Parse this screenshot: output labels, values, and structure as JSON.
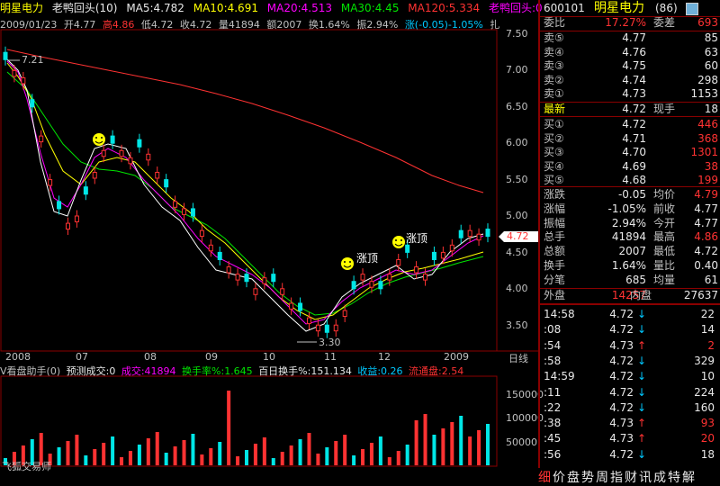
{
  "header": {
    "stock_name": "明星电力",
    "indicator": "老鸭回头(10)",
    "ma5": "MA5:4.782",
    "ma10": "MA10:4.691",
    "ma20": "MA20:4.513",
    "ma30": "MA30:4.45",
    "ma120": "MA120:5.334",
    "indicator_value": "老鸭回头:0"
  },
  "info": {
    "date": "2009/01/23",
    "open": "开4.77",
    "high": "高4.86",
    "low": "低4.72",
    "close": "收4.72",
    "volume": "量41894",
    "amount": "额2007",
    "turnover": "换1.64%",
    "amplitude": "振2.94%",
    "change": "涨(-0.05)-1.05%",
    "trailing": "扎"
  },
  "price_axis": [
    "7.50",
    "7.00",
    "6.50",
    "6.00",
    "5.50",
    "5.00",
    "4.50",
    "4.00",
    "3.50"
  ],
  "current_price_tag": "4.72",
  "annotations": {
    "high": "7.21",
    "low": "3.30",
    "label1": "涨顶",
    "label2": "涨顶"
  },
  "time_axis": [
    "2008",
    "07",
    "08",
    "09",
    "10",
    "11",
    "12",
    "2009"
  ],
  "period": "日线",
  "volume_info": {
    "helper": "V看盘助手(0)",
    "forecast": "预测成交:0",
    "volume": "成交:41894",
    "turnover_rate": "换手率%:1.645",
    "hundred_day": "百日换手%:151.134",
    "shares": "收益:0.26",
    "float": "流通盘:2.54"
  },
  "volume_axis": [
    "150000",
    "100000",
    "50000"
  ],
  "brand": "飞狐交易师",
  "quote": {
    "code": "600101",
    "name": "明星电力",
    "num": "(86)",
    "wei_bi_label": "委比",
    "wei_bi": "17.27%",
    "wei_cha_label": "委差",
    "wei_cha": "693",
    "sell": [
      {
        "label": "卖⑤",
        "price": "4.77",
        "vol": "85"
      },
      {
        "label": "卖④",
        "price": "4.76",
        "vol": "63"
      },
      {
        "label": "卖③",
        "price": "4.75",
        "vol": "60"
      },
      {
        "label": "卖②",
        "price": "4.74",
        "vol": "298"
      },
      {
        "label": "卖①",
        "price": "4.73",
        "vol": "1153"
      }
    ],
    "latest_label": "最新",
    "latest": "4.72",
    "now_vol_label": "现手",
    "now_vol": "18",
    "buy": [
      {
        "label": "买①",
        "price": "4.72",
        "vol": "446"
      },
      {
        "label": "买②",
        "price": "4.71",
        "vol": "368"
      },
      {
        "label": "买③",
        "price": "4.70",
        "vol": "1301"
      },
      {
        "label": "买④",
        "price": "4.69",
        "vol": "38"
      },
      {
        "label": "买⑤",
        "price": "4.68",
        "vol": "199"
      }
    ],
    "stats": [
      {
        "l1": "涨跌",
        "v1": "-0.05",
        "l2": "均价",
        "v2": "4.79"
      },
      {
        "l1": "涨幅",
        "v1": "-1.05%",
        "l2": "前收",
        "v2": "4.77"
      },
      {
        "l1": "振幅",
        "v1": "2.94%",
        "l2": "今开",
        "v2": "4.77"
      },
      {
        "l1": "总手",
        "v1": "41894",
        "l2": "最高",
        "v2": "4.86"
      },
      {
        "l1": "总额",
        "v1": "2007",
        "l2": "最低",
        "v2": "4.72"
      },
      {
        "l1": "换手",
        "v1": "1.64%",
        "l2": "量比",
        "v2": "0.40"
      },
      {
        "l1": "分笔",
        "v1": "685",
        "l2": "均量",
        "v2": "61"
      }
    ],
    "outer_label": "外盘",
    "outer": "14257",
    "inner_label": "内盘",
    "inner": "27637"
  },
  "ticks": [
    {
      "time": "14:58",
      "price": "4.72",
      "dir": "↓",
      "vol": "22"
    },
    {
      "time": ":08",
      "price": "4.72",
      "dir": "↓",
      "vol": "14"
    },
    {
      "time": ":54",
      "price": "4.73",
      "dir": "↑",
      "vol": "2"
    },
    {
      "time": ":58",
      "price": "4.72",
      "dir": "↓",
      "vol": "329"
    },
    {
      "time": "14:59",
      "price": "4.72",
      "dir": "↓",
      "vol": "10"
    },
    {
      "time": ":11",
      "price": "4.72",
      "dir": "↓",
      "vol": "224"
    },
    {
      "time": ":22",
      "price": "4.72",
      "dir": "↓",
      "vol": "160"
    },
    {
      "time": ":38",
      "price": "4.73",
      "dir": "↑",
      "vol": "93"
    },
    {
      "time": ":45",
      "price": "4.73",
      "dir": "↑",
      "vol": "20"
    },
    {
      "time": ":56",
      "price": "4.72",
      "dir": "↓",
      "vol": "18"
    }
  ],
  "bottom_tabs": [
    "细",
    "价",
    "盘",
    "势",
    "周",
    "指",
    "财",
    "讯",
    "成",
    "特",
    "解"
  ],
  "colors": {
    "up": "#ff3232",
    "down": "#00e6e6",
    "ma5": "#ffffff",
    "ma10": "#ffff00",
    "ma20": "#ff00ff",
    "ma30": "#00e600",
    "ma120": "#ff3232"
  }
}
